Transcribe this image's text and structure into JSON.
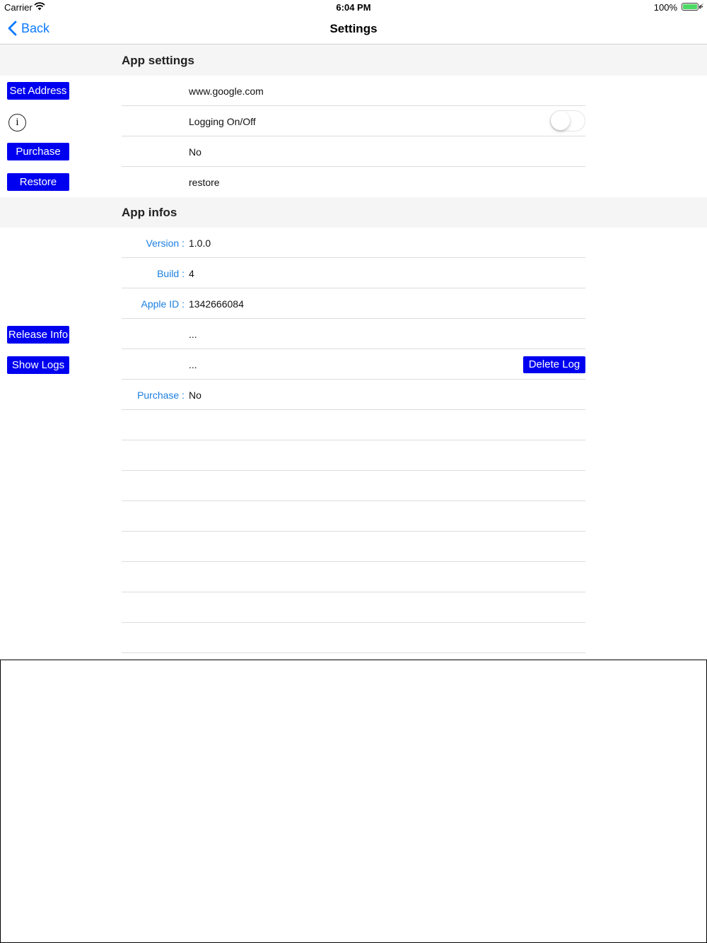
{
  "status_bar": {
    "carrier": "Carrier",
    "time": "6:04 PM",
    "battery": "100%"
  },
  "nav": {
    "back_label": "Back",
    "title": "Settings"
  },
  "sections": {
    "app_settings": "App settings",
    "app_infos": "App infos"
  },
  "settings": {
    "set_address_button": "Set Address",
    "address_value": "www.google.com",
    "logging_value": "Logging On/Off",
    "logging_enabled": false,
    "purchase_button": "Purchase",
    "purchase_value": "No",
    "restore_button": "Restore",
    "restore_value": "restore"
  },
  "infos": {
    "version_label": "Version :",
    "version_value": "1.0.0",
    "build_label": "Build :",
    "build_value": "4",
    "apple_id_label": "Apple ID :",
    "apple_id_value": "1342666084",
    "release_info_button": "Release Info",
    "release_info_value": "...",
    "show_logs_button": "Show Logs",
    "show_logs_value": "...",
    "delete_log_button": "Delete Log",
    "purchase_label": "Purchase :",
    "purchase_value": "No"
  },
  "colors": {
    "accent": "#0a7aff",
    "button_bg": "#0000f0",
    "label_blue": "#1a7fe0",
    "section_bg": "#f5f5f5"
  }
}
